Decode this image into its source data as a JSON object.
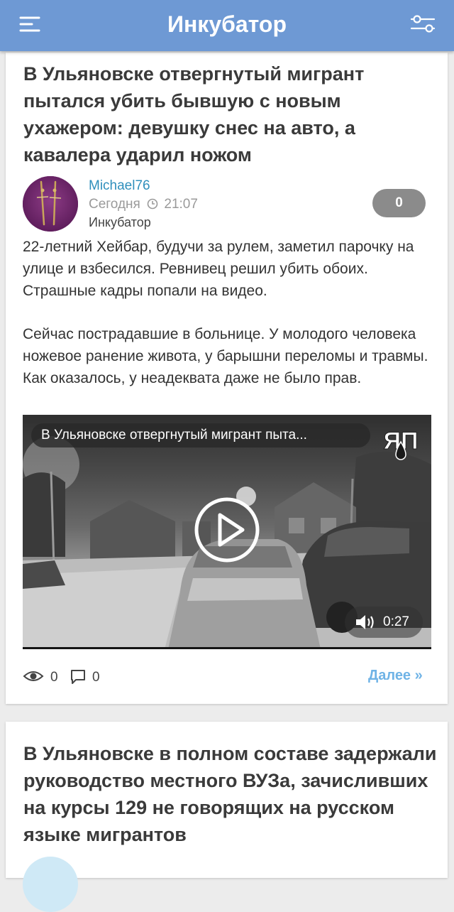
{
  "app": {
    "title": "Инкубатор",
    "accent_color": "#6e99d4",
    "menu_icon": "hamburger-menu-icon",
    "filter_icon": "filter-sliders-icon"
  },
  "posts": [
    {
      "title": "В Ульяновске отвергнутый мигрант пытался убить бывшую с новым ухажером: девушку снес на авто, а кавалера ударил ножом",
      "author": "Michael76",
      "date": "Сегодня",
      "time": "21:07",
      "category": "Инкубатор",
      "comment_count": "0",
      "paragraphs": [
        "22-летний Хейбар, будучи за рулем, заметил парочку на улице и взбесился. Ревнивец решил убить обоих. Страшные кадры попали на видео.",
        "Сейчас пострадавшие в больнице. У молодого человека ножевое ранение живота, у барышни переломы и травмы. Как оказалось, у неадеквата даже не было прав."
      ],
      "video": {
        "title": "В Ульяновске отвергнутый мигрант пыта...",
        "channel_logo_text": "ЯП",
        "duration": "0:27"
      },
      "views": "0",
      "comments": "0",
      "more_label": "Далее »"
    },
    {
      "title": "В Ульяновске в полном составе задержали руководство местного ВУЗа, зачисливших на курсы 129 не говорящих на русском языке мигрантов"
    }
  ]
}
